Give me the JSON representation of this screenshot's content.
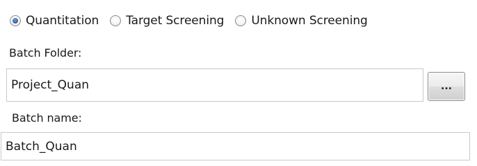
{
  "mode": {
    "options": [
      {
        "label": "Quantitation",
        "selected": true
      },
      {
        "label": "Target Screening",
        "selected": false
      },
      {
        "label": "Unknown Screening",
        "selected": false
      }
    ]
  },
  "batch_folder": {
    "label": "Batch Folder:",
    "value": "Project_Quan",
    "browse_label": "..."
  },
  "batch_name": {
    "label": "Batch name:",
    "value": "Batch_Quan"
  }
}
